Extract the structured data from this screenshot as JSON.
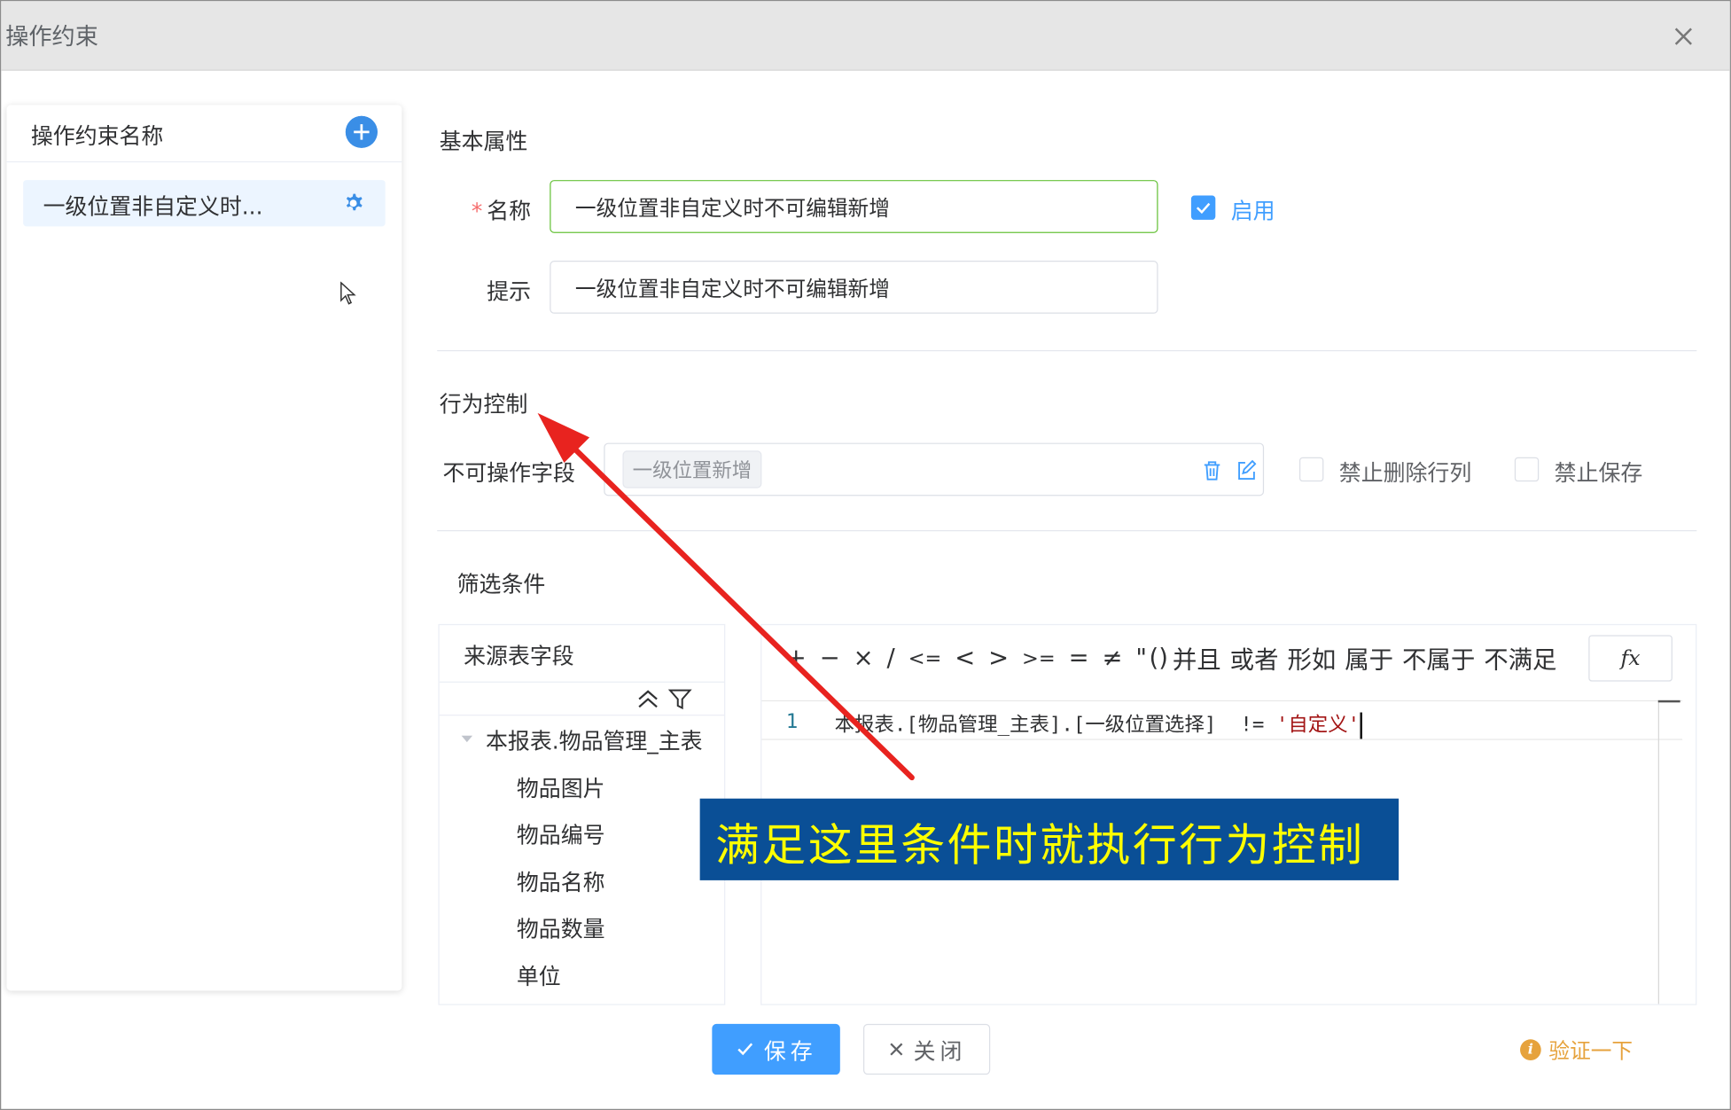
{
  "dialog": {
    "title": "操作约束"
  },
  "left_panel": {
    "header": "操作约束名称",
    "items": [
      {
        "label": "一级位置非自定义时..."
      }
    ]
  },
  "basic": {
    "section_title": "基本属性",
    "name_label": "名称",
    "name_value": "一级位置非自定义时不可编辑新增",
    "enable_label": "启用",
    "enable_checked": true,
    "hint_label": "提示",
    "hint_value": "一级位置非自定义时不可编辑新增"
  },
  "behavior": {
    "section_title": "行为控制",
    "fields_label": "不可操作字段",
    "fields_tags": [
      "一级位置新增"
    ],
    "forbid_delete_label": "禁止删除行列",
    "forbid_save_label": "禁止保存"
  },
  "filter": {
    "section_title": "筛选条件",
    "source_header": "来源表字段",
    "tree_root": "本报表.物品管理_主表",
    "tree_children": [
      "物品图片",
      "物品编号",
      "物品名称",
      "物品数量",
      "单位"
    ],
    "operators": [
      "+",
      "−",
      "×",
      "/",
      "<=",
      "<",
      ">",
      ">=",
      "=",
      "≠",
      "\"",
      "()",
      "并且",
      "或者",
      "形如",
      "属于",
      "不属于",
      "不满足"
    ],
    "fx_label": "fx",
    "line_number": "1",
    "code_plain": "本报表.[物品管理_主表].[一级位置选择]  != ",
    "code_string": "'自定义'"
  },
  "footer": {
    "save_label": "保存",
    "close_label": "关闭",
    "verify_label": "验证一下"
  },
  "annotation": {
    "text": "满足这里条件时就执行行为控制"
  },
  "colors": {
    "primary": "#409eff",
    "annotation_bg": "#0a4f96",
    "annotation_text": "#ffff00",
    "arrow": "#e8231f",
    "warning": "#e6a23c"
  },
  "icons": {
    "close": "close-icon",
    "add": "plus-circle-icon",
    "settings": "gear-icon",
    "delete": "trash-icon",
    "edit": "edit-icon",
    "collapse": "double-chevron-up-icon",
    "filter": "funnel-icon",
    "info": "info-icon"
  }
}
